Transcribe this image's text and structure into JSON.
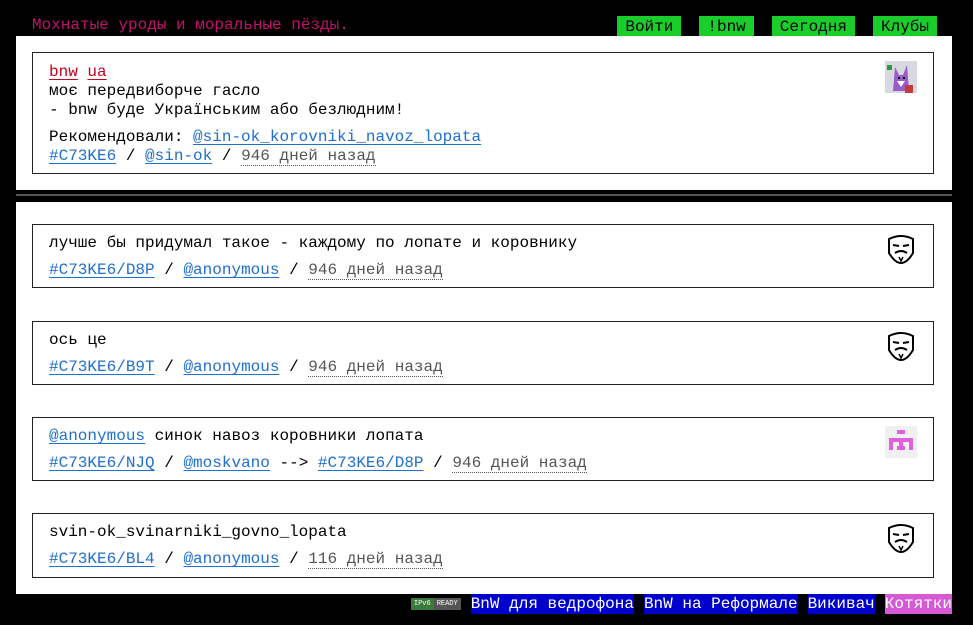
{
  "site_title": "Мохнатые уроды и моральные пёзды.",
  "nav": [
    "Войти",
    "!bnw",
    "Сегодня",
    "Клубы"
  ],
  "main_post": {
    "tags": [
      "bnw",
      "ua"
    ],
    "line1": "моє передвиборче гасло",
    "line2": "- bnw буде Українським або безлюдним!",
    "recommended_label": "Рекомендовали:",
    "recommended_by": "@sin-ok_korovniki_navoz_lopata",
    "id": "#C73KE6",
    "author": "@sin-ok",
    "time": "946 дней назад"
  },
  "replies": [
    {
      "text": "лучше бы придумал такое - каждому по лопате и коровнику",
      "id": "#C73KE6/D8P",
      "author": "@anonymous",
      "time": "946 дней назад",
      "avatar": "mask-icon"
    },
    {
      "text": "ось це",
      "id": "#C73KE6/B9T",
      "author": "@anonymous",
      "time": "946 дней назад",
      "avatar": "mask-icon"
    },
    {
      "mention": "@anonymous",
      "text": "синок навоз коровники лопата",
      "id": "#C73KE6/NJQ",
      "author": "@moskvano",
      "arrow": "-->",
      "reply_to": "#C73KE6/D8P",
      "time": "946 дней назад",
      "avatar": "pixel-invader-icon"
    },
    {
      "text": "svin-ok_svinarniki_govno_lopata",
      "id": "#C73KE6/BL4",
      "author": "@anonymous",
      "time": "116 дней назад",
      "avatar": "mask-icon"
    }
  ],
  "separator": "/",
  "footer": {
    "badge_left": "IPv6",
    "badge_right": "READY",
    "links": [
      "BnW для ведрофона",
      "BnW на Реформале",
      "Викивач",
      "Котятки"
    ]
  },
  "colors": {
    "title": "#c4106e",
    "nav_bg": "#1acd2a",
    "link": "#1f6fcf",
    "tag": "#c4001f",
    "footer_link_bg": "#0000cc",
    "footer_pink": "#d65ad6"
  }
}
